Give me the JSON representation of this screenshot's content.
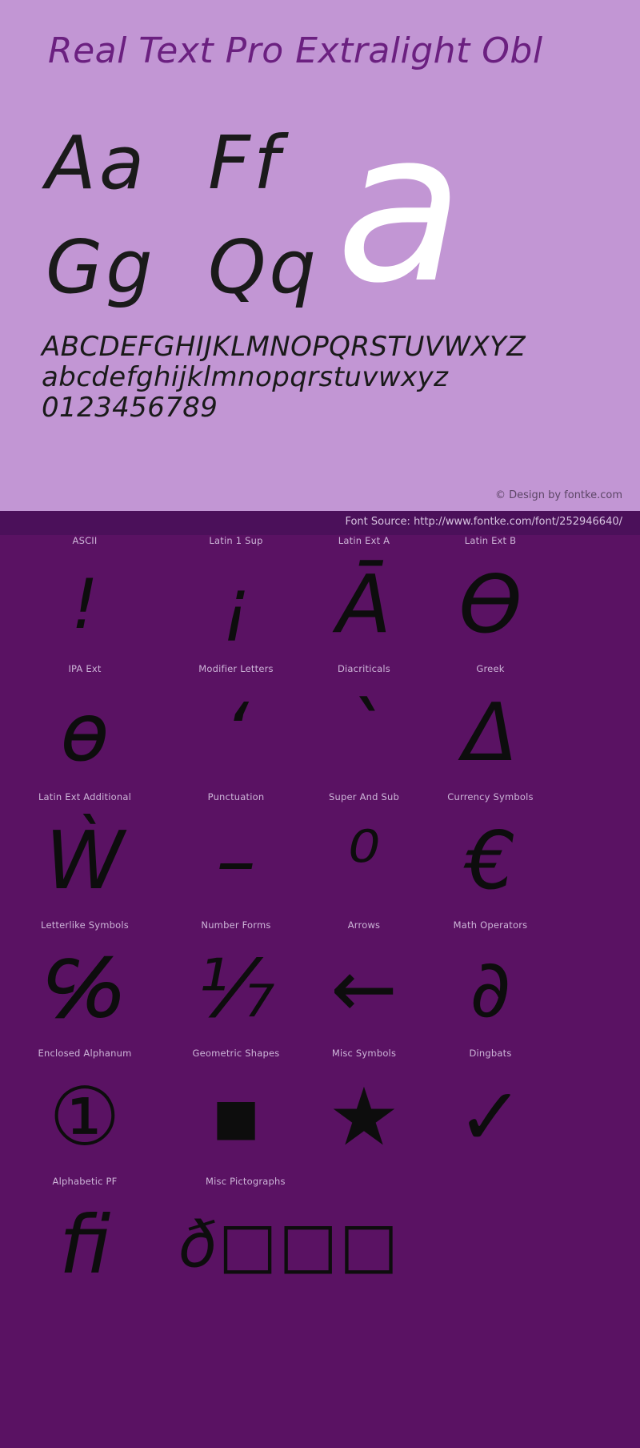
{
  "specimen": {
    "title": "Real Text Pro Extralight Obl",
    "letter_pairs": [
      "Aa",
      "Ff",
      "Gg",
      "Qq"
    ],
    "feature_glyph": "a",
    "alphabet_upper": "ABCDEFGHIJKLMNOPQRSTUVWXYZ",
    "alphabet_lower": "abcdefghijklmnopqrstuvwxyz",
    "digits": "0123456789",
    "credit": "© Design by fontke.com"
  },
  "source_bar": {
    "text": "Font Source: http://www.fontke.com/font/252946640/"
  },
  "glyph_map": {
    "rows": [
      {
        "cells": [
          {
            "label": "ASCII",
            "glyph": "!"
          },
          {
            "label": "Latin 1 Sup",
            "glyph": "¡"
          },
          {
            "label": "Latin Ext A",
            "glyph": "Ā"
          },
          {
            "label": "Latin Ext B",
            "glyph": "Ɵ"
          }
        ]
      },
      {
        "cells": [
          {
            "label": "IPA Ext",
            "glyph": "ɵ"
          },
          {
            "label": "Modifier Letters",
            "glyph": "ʻ"
          },
          {
            "label": "Diacriticals",
            "glyph": "`"
          },
          {
            "label": "Greek",
            "glyph": "Δ"
          }
        ]
      },
      {
        "cells": [
          {
            "label": "Latin Ext Additional",
            "glyph": "Ẁ"
          },
          {
            "label": "Punctuation",
            "glyph": "–"
          },
          {
            "label": "Super And Sub",
            "glyph": "⁰"
          },
          {
            "label": "Currency Symbols",
            "glyph": "€"
          }
        ]
      },
      {
        "cells": [
          {
            "label": "Letterlike Symbols",
            "glyph": "℅"
          },
          {
            "label": "Number Forms",
            "glyph": "⅐"
          },
          {
            "label": "Arrows",
            "glyph": "←"
          },
          {
            "label": "Math Operators",
            "glyph": "∂"
          }
        ]
      },
      {
        "cells": [
          {
            "label": "Enclosed Alphanum",
            "glyph": "①"
          },
          {
            "label": "Geometric Shapes",
            "glyph": "■"
          },
          {
            "label": "Misc Symbols",
            "glyph": "★"
          },
          {
            "label": "Dingbats",
            "glyph": "✓"
          }
        ]
      },
      {
        "cells": [
          {
            "label": "Alphabetic PF",
            "glyph": "ﬁ"
          },
          {
            "label": "Misc Pictographs",
            "glyph": "ð□□□"
          }
        ]
      }
    ]
  },
  "colors": {
    "specimen_background": "#c296d4",
    "map_background": "#5a1263",
    "source_bar_background": "#4b105a",
    "title_text": "#6b2080",
    "glyph_text": "#0d0d0d",
    "feature_glyph": "#ffffff",
    "label_text": "#cdb5d8"
  }
}
